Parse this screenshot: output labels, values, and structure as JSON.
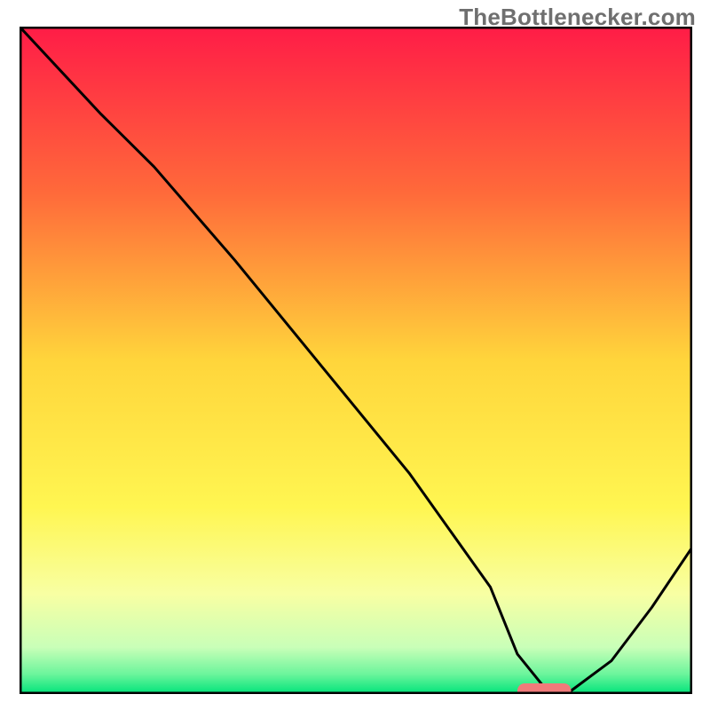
{
  "watermark": "TheBottlenecker.com",
  "chart_data": {
    "type": "line",
    "title": "",
    "xlabel": "",
    "ylabel": "",
    "xlim": [
      0,
      100
    ],
    "ylim": [
      0,
      100
    ],
    "grid": false,
    "legend": false,
    "gradient_stops": [
      {
        "offset": 0.0,
        "color": "#ff1c47"
      },
      {
        "offset": 0.25,
        "color": "#ff6a3a"
      },
      {
        "offset": 0.5,
        "color": "#ffd53b"
      },
      {
        "offset": 0.72,
        "color": "#fff651"
      },
      {
        "offset": 0.85,
        "color": "#f8ffa3"
      },
      {
        "offset": 0.93,
        "color": "#c9ffb8"
      },
      {
        "offset": 0.97,
        "color": "#6cf59c"
      },
      {
        "offset": 1.0,
        "color": "#00e37a"
      }
    ],
    "series": [
      {
        "name": "bottleneck-curve",
        "color": "#000000",
        "x": [
          0,
          12,
          20,
          32,
          45,
          58,
          70,
          74,
          78,
          82,
          88,
          94,
          100
        ],
        "values": [
          100,
          87,
          79,
          65,
          49,
          33,
          16,
          6,
          1,
          0.5,
          5,
          13,
          22
        ]
      }
    ],
    "marker": {
      "name": "optimal-marker",
      "color": "#f07a7a",
      "x_start": 74,
      "x_end": 82,
      "y": 0.5,
      "thickness_pct": 2.2
    }
  }
}
